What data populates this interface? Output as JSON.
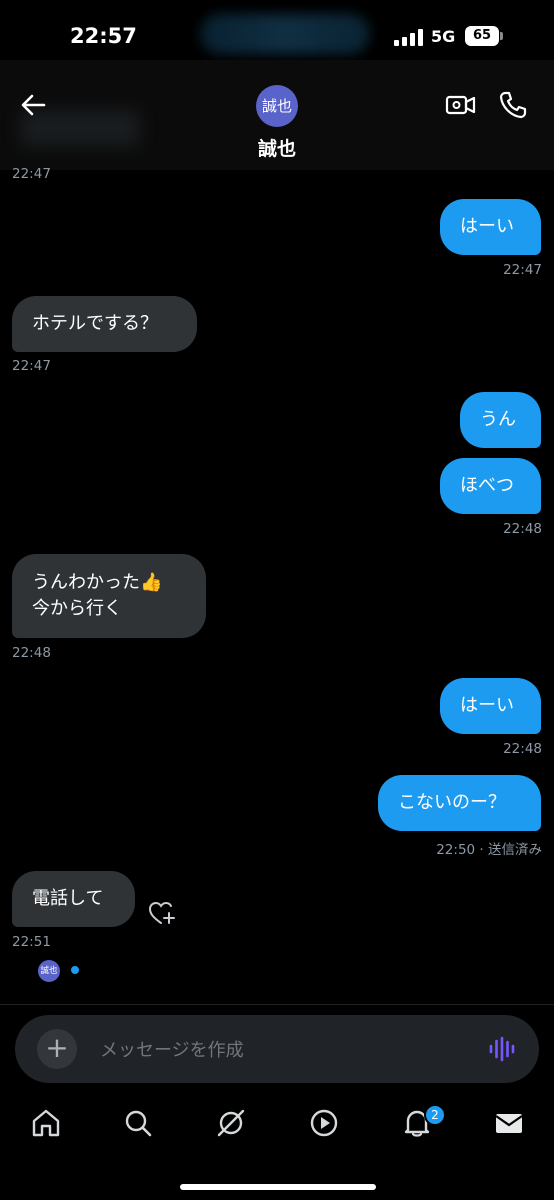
{
  "status_bar": {
    "time": "22:57",
    "network": "5G",
    "battery": "65"
  },
  "header": {
    "contact_avatar_text": "誠也",
    "contact_name": "誠也"
  },
  "messages": [
    {
      "direction": "in_time_only",
      "time": "22:47"
    },
    {
      "direction": "outgoing",
      "text": "はーい",
      "time": "22:47"
    },
    {
      "direction": "incoming",
      "text": "ホテルでする？",
      "time": "22:47"
    },
    {
      "direction": "outgoing",
      "text": "うん"
    },
    {
      "direction": "outgoing",
      "text": "ほべつ",
      "time": "22:48"
    },
    {
      "direction": "incoming",
      "lines": [
        "うんわかった👍",
        "今から行く"
      ],
      "time": "22:48"
    },
    {
      "direction": "outgoing",
      "text": "はーい",
      "time": "22:48"
    },
    {
      "direction": "outgoing",
      "text": "こないのー？",
      "time": "22:50 · 送信済み"
    },
    {
      "direction": "incoming",
      "text": "電話して",
      "time": "22:51"
    }
  ],
  "read_receipt": {
    "avatar_text": "誠也"
  },
  "composer": {
    "plus": "+",
    "placeholder": "メッセージを作成"
  },
  "nav": {
    "items": [
      "home-icon",
      "search-icon",
      "grok-icon",
      "video-icon",
      "bell-icon",
      "mail-icon"
    ],
    "notification_badge": "2"
  },
  "colors": {
    "accent": "#1d9bf0",
    "incoming_bubble": "#2f3336",
    "avatar": "#5a63c9"
  }
}
